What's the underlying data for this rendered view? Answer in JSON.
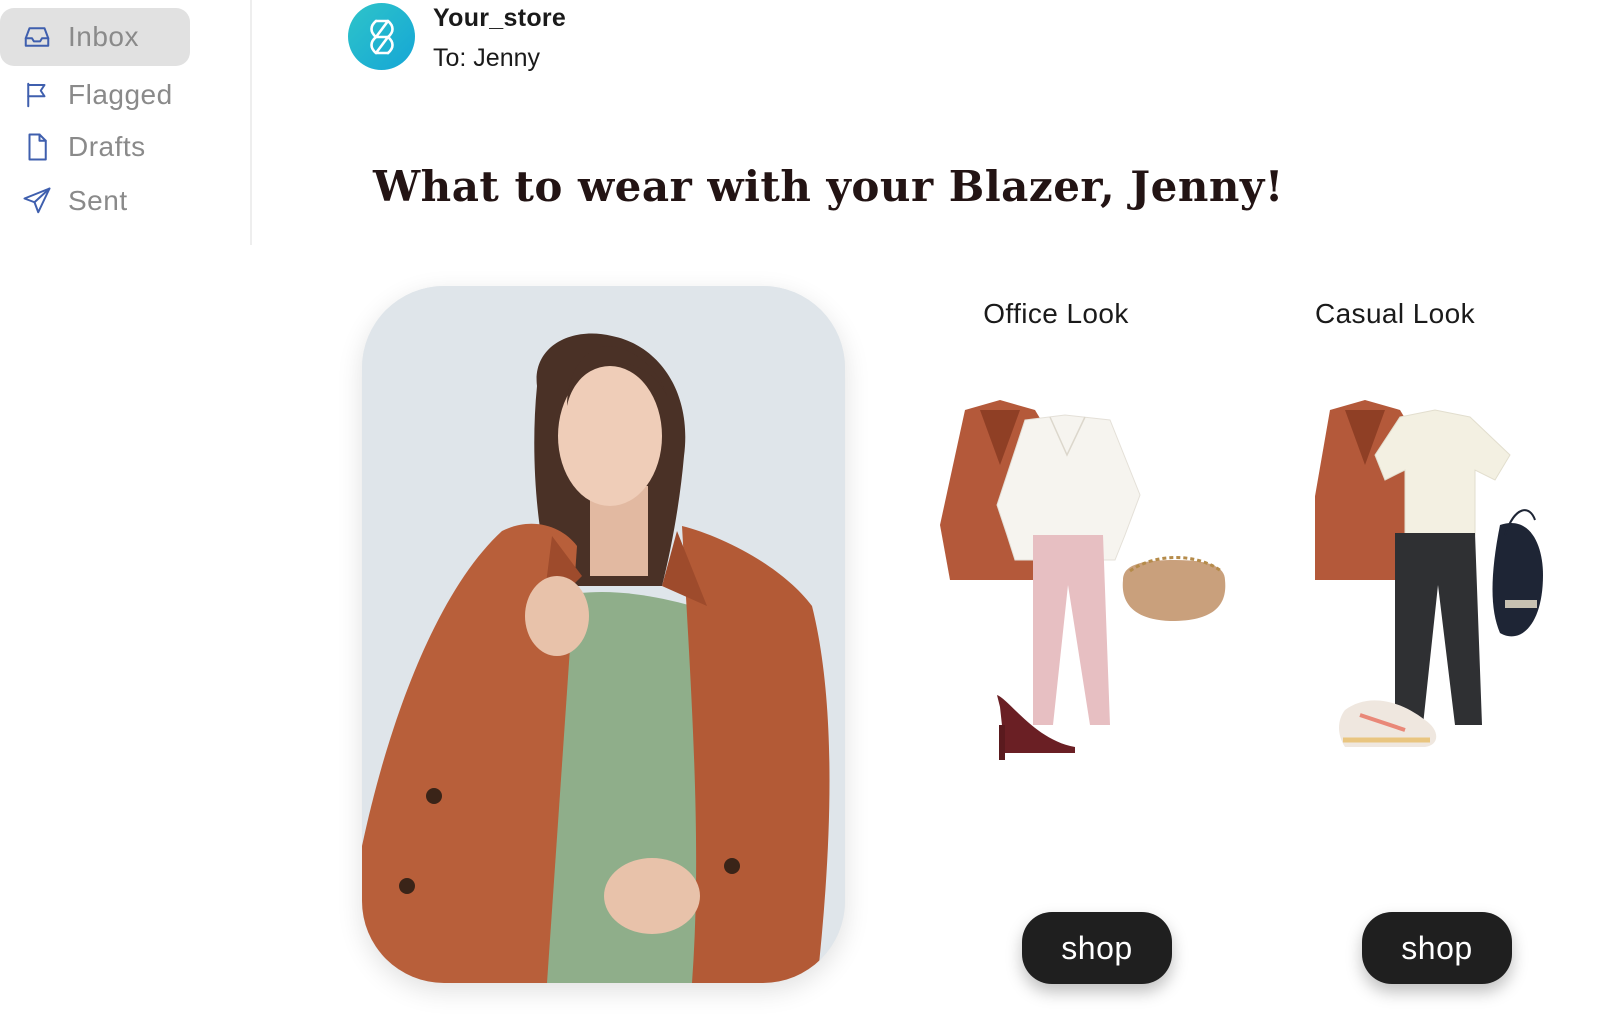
{
  "sidebar": {
    "items": [
      {
        "label": "Inbox",
        "icon": "inbox-icon",
        "active": true
      },
      {
        "label": "Flagged",
        "icon": "flag-icon",
        "active": false
      },
      {
        "label": "Drafts",
        "icon": "document-icon",
        "active": false
      },
      {
        "label": "Sent",
        "icon": "send-icon",
        "active": false
      }
    ]
  },
  "email": {
    "sender": "Your_store",
    "recipient": "To: Jenny",
    "headline": "What to wear with your Blazer, Jenny!"
  },
  "looks": [
    {
      "title": "Office Look",
      "button_label": "shop"
    },
    {
      "title": "Casual Look",
      "button_label": "shop"
    }
  ],
  "colors": {
    "accent_blue": "#3f5fae",
    "avatar_gradient_start": "#2ec4c9",
    "avatar_gradient_end": "#15a6d6",
    "button_bg": "#1f1f1f",
    "active_nav_bg": "#e1e1e1",
    "headline": "#231414"
  }
}
